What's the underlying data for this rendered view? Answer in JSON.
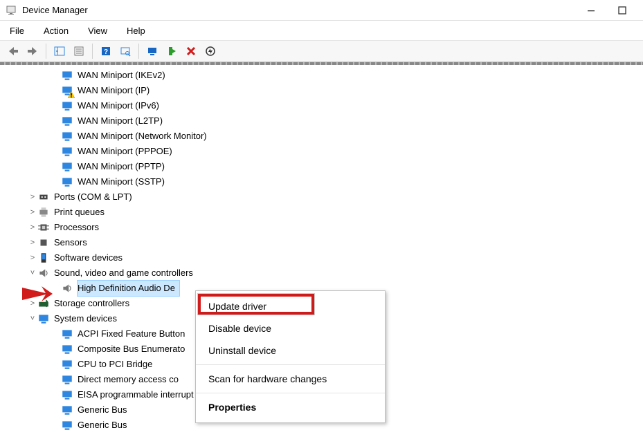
{
  "window": {
    "title": "Device Manager"
  },
  "menubar": {
    "file": "File",
    "action": "Action",
    "view": "View",
    "help": "Help"
  },
  "tree": {
    "wan": [
      "WAN Miniport (IKEv2)",
      "WAN Miniport (IP)",
      "WAN Miniport (IPv6)",
      "WAN Miniport (L2TP)",
      "WAN Miniport (Network Monitor)",
      "WAN Miniport (PPPOE)",
      "WAN Miniport (PPTP)",
      "WAN Miniport (SSTP)"
    ],
    "cats": {
      "ports": "Ports (COM & LPT)",
      "printq": "Print queues",
      "proc": "Processors",
      "sensors": "Sensors",
      "softdev": "Software devices",
      "svg": "Sound, video and game controllers",
      "hda": "High Definition Audio De",
      "storage": "Storage controllers",
      "sysdev": "System devices"
    },
    "sysd": [
      "ACPI Fixed Feature Button",
      "Composite Bus Enumerato",
      "CPU to PCI Bridge",
      "Direct memory access co",
      "EISA programmable interrupt controller",
      "Generic Bus",
      "Generic Bus"
    ]
  },
  "context_menu": {
    "update": "Update driver",
    "disable": "Disable device",
    "uninstall": "Uninstall device",
    "scan": "Scan for hardware changes",
    "properties": "Properties"
  }
}
